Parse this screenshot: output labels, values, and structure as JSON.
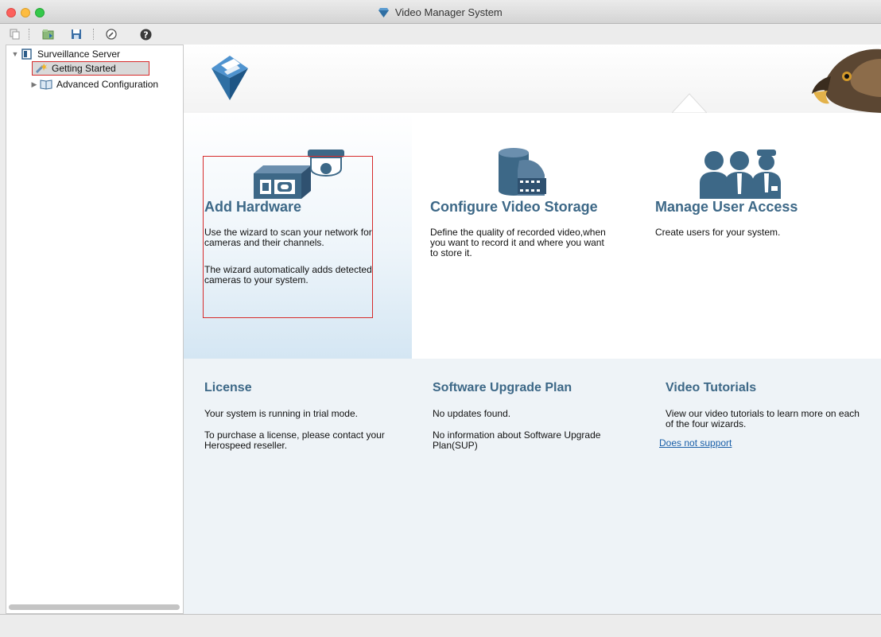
{
  "window": {
    "title": "Video Manager System"
  },
  "toolbar": {
    "buttons": [
      "copy-icon",
      "import-icon",
      "save-icon",
      "settings-icon",
      "help-icon"
    ]
  },
  "tree": {
    "root": "Surveillance Server",
    "items": [
      {
        "label": "Getting Started",
        "selected": true
      },
      {
        "label": "Advanced Configuration",
        "selected": false
      }
    ]
  },
  "wizards": [
    {
      "title": "Add Hardware",
      "desc1": "Use the wizard to scan your network for cameras and their channels.",
      "desc2": "The wizard automatically adds detected cameras to your system."
    },
    {
      "title": "Configure Video Storage",
      "desc1": "Define the quality of recorded video,when you want to record it and where you want to store it."
    },
    {
      "title": "Manage User Access",
      "desc1": "Create users for your system."
    }
  ],
  "info": {
    "license": {
      "title": "License",
      "line1": "Your system is running in trial mode.",
      "line2": "To purchase a license, please contact your Herospeed reseller."
    },
    "upgrade": {
      "title": "Software Upgrade Plan",
      "line1": "No updates found.",
      "line2": "No information about Software Upgrade Plan(SUP)"
    },
    "tutorials": {
      "title": "Video Tutorials",
      "line1": "View our video tutorials to learn more on each of the four wizards.",
      "link": "Does not support"
    }
  },
  "colors": {
    "accent": "#3d6887",
    "link": "#1a5fa8",
    "highlight": "#d62b2b"
  }
}
